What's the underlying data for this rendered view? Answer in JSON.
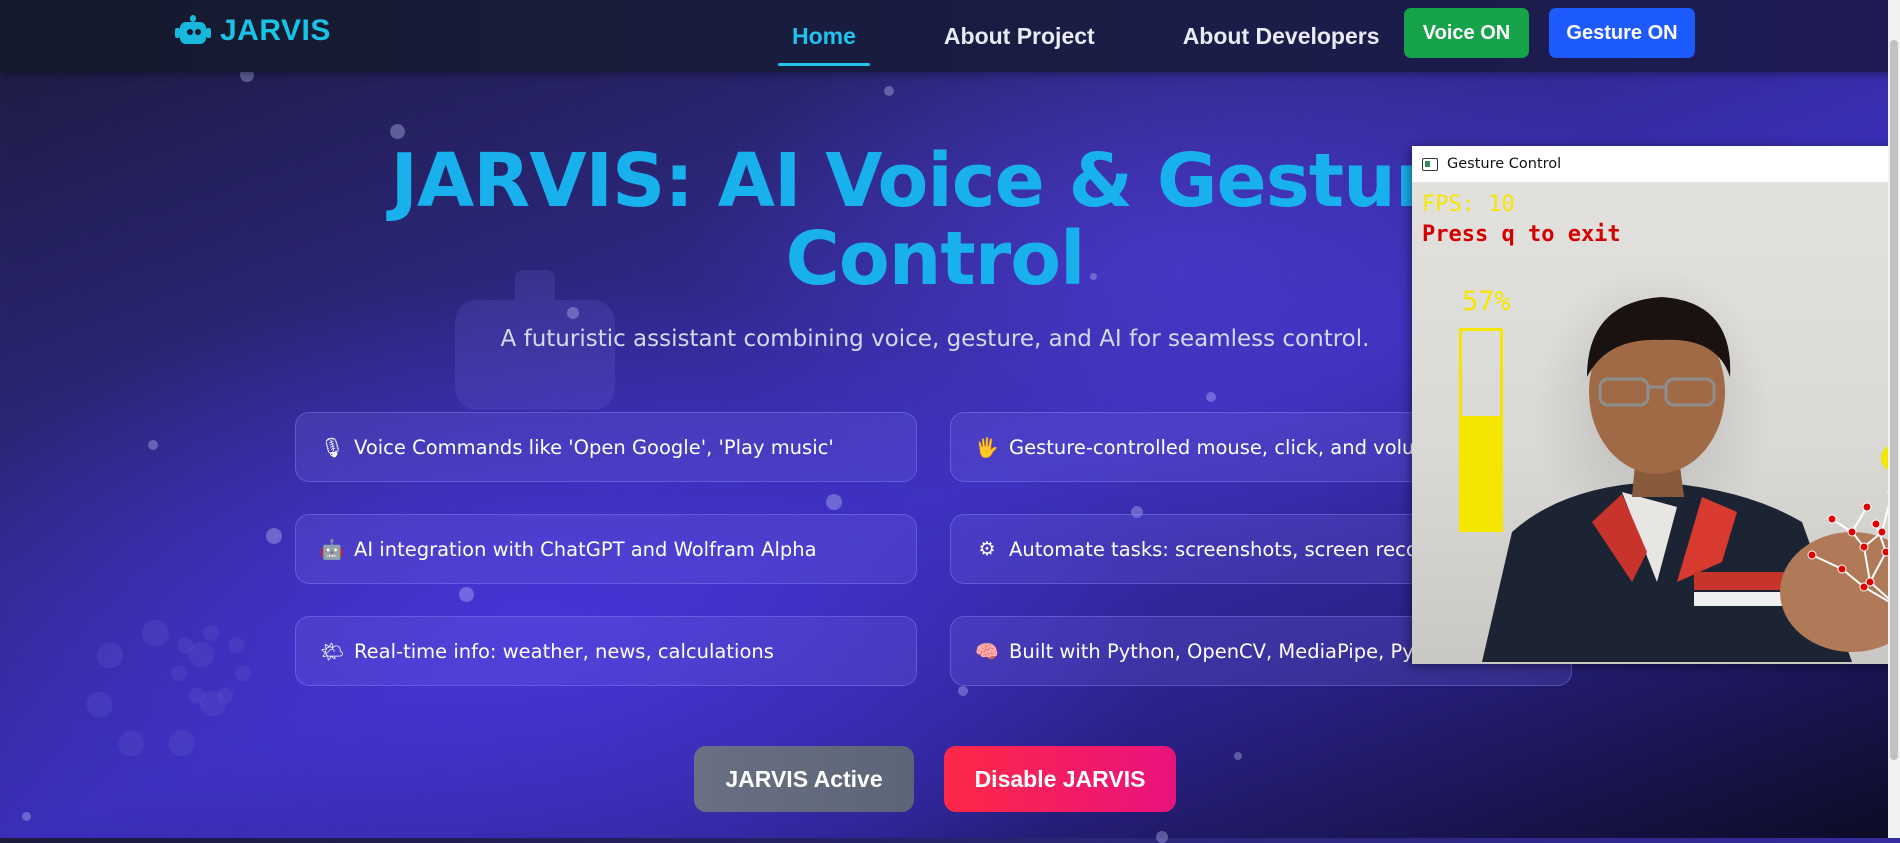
{
  "brand": {
    "name": "JARVIS",
    "icon": "robot-icon",
    "color": "#19c3e6"
  },
  "nav": {
    "links": [
      {
        "label": "Home",
        "active": true
      },
      {
        "label": "About Project",
        "active": false
      },
      {
        "label": "About Developers",
        "active": false
      }
    ],
    "voice_button": "Voice ON",
    "gesture_button": "Gesture ON"
  },
  "hero": {
    "title_line1": "JARVIS: AI Voice & Gesture",
    "title_line2": "Control",
    "subtitle": "A futuristic assistant combining voice, gesture, and AI for seamless control."
  },
  "features": [
    {
      "icon": "microphone-icon",
      "glyph": "🎙",
      "text": "Voice Commands like 'Open Google', 'Play music'"
    },
    {
      "icon": "hand-icon",
      "glyph": "🖐",
      "text": "Gesture-controlled mouse, click, and volume"
    },
    {
      "icon": "robot-icon",
      "glyph": "🤖",
      "text": "AI integration with ChatGPT and Wolfram Alpha"
    },
    {
      "icon": "gear-icon",
      "glyph": "⚙",
      "text": "Automate tasks: screenshots, screen record, sy"
    },
    {
      "icon": "weather-icon",
      "glyph": "🌤",
      "text": "Real-time info: weather, news, calculations"
    },
    {
      "icon": "brain-icon",
      "glyph": "🧠",
      "text": "Built with Python, OpenCV, MediaPipe, PyAudio"
    }
  ],
  "actions": {
    "active_label": "JARVIS Active",
    "disable_label": "Disable JARVIS"
  },
  "gesture_window": {
    "title": "Gesture Control",
    "fps_text": "FPS: 10",
    "exit_text": "Press q to exit",
    "volume_text": "57%",
    "volume_level": 0.57
  },
  "colors": {
    "accent": "#20c3ea",
    "voice_on": "#16a34a",
    "gesture_on": "#1e5bff",
    "disable_start": "#ff2846",
    "disable_end": "#e8127e"
  }
}
